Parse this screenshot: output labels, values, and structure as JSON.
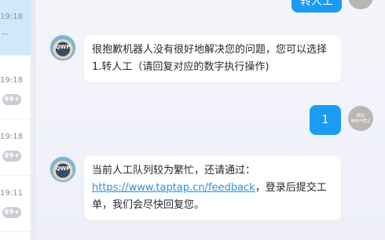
{
  "sidebar": {
    "conversations": [
      {
        "time": "19:18",
        "snippet": "...",
        "badge": ""
      },
      {
        "time": "19:18",
        "snippet": "",
        "badge": "99+"
      },
      {
        "time": "19:18",
        "snippet": "",
        "badge": "99+"
      },
      {
        "time": "19:11",
        "snippet": "",
        "badge": "99+"
      }
    ]
  },
  "chat": {
    "top_user_message": "转人工",
    "bot_message_1": "很抱歉机器人没有很好地解决您的问题，您可以选择1.转人工（请回复对应的数字执行操作)",
    "user_message": "1",
    "bot_message_2": {
      "text_before": "当前人工队列较为繁忙，还请通过：",
      "link": "https://www.taptap.cn/feedback",
      "text_after": "，登录后提交工单，我们会尽快回复您。"
    },
    "bot_avatar_label": "QWP",
    "user_avatar_lines": [
      "疯狂",
      "我的气质又"
    ]
  },
  "colors": {
    "accent": "#1a9cf2",
    "active_conversation": "#cfe9fb",
    "link": "#2b8fe0"
  }
}
